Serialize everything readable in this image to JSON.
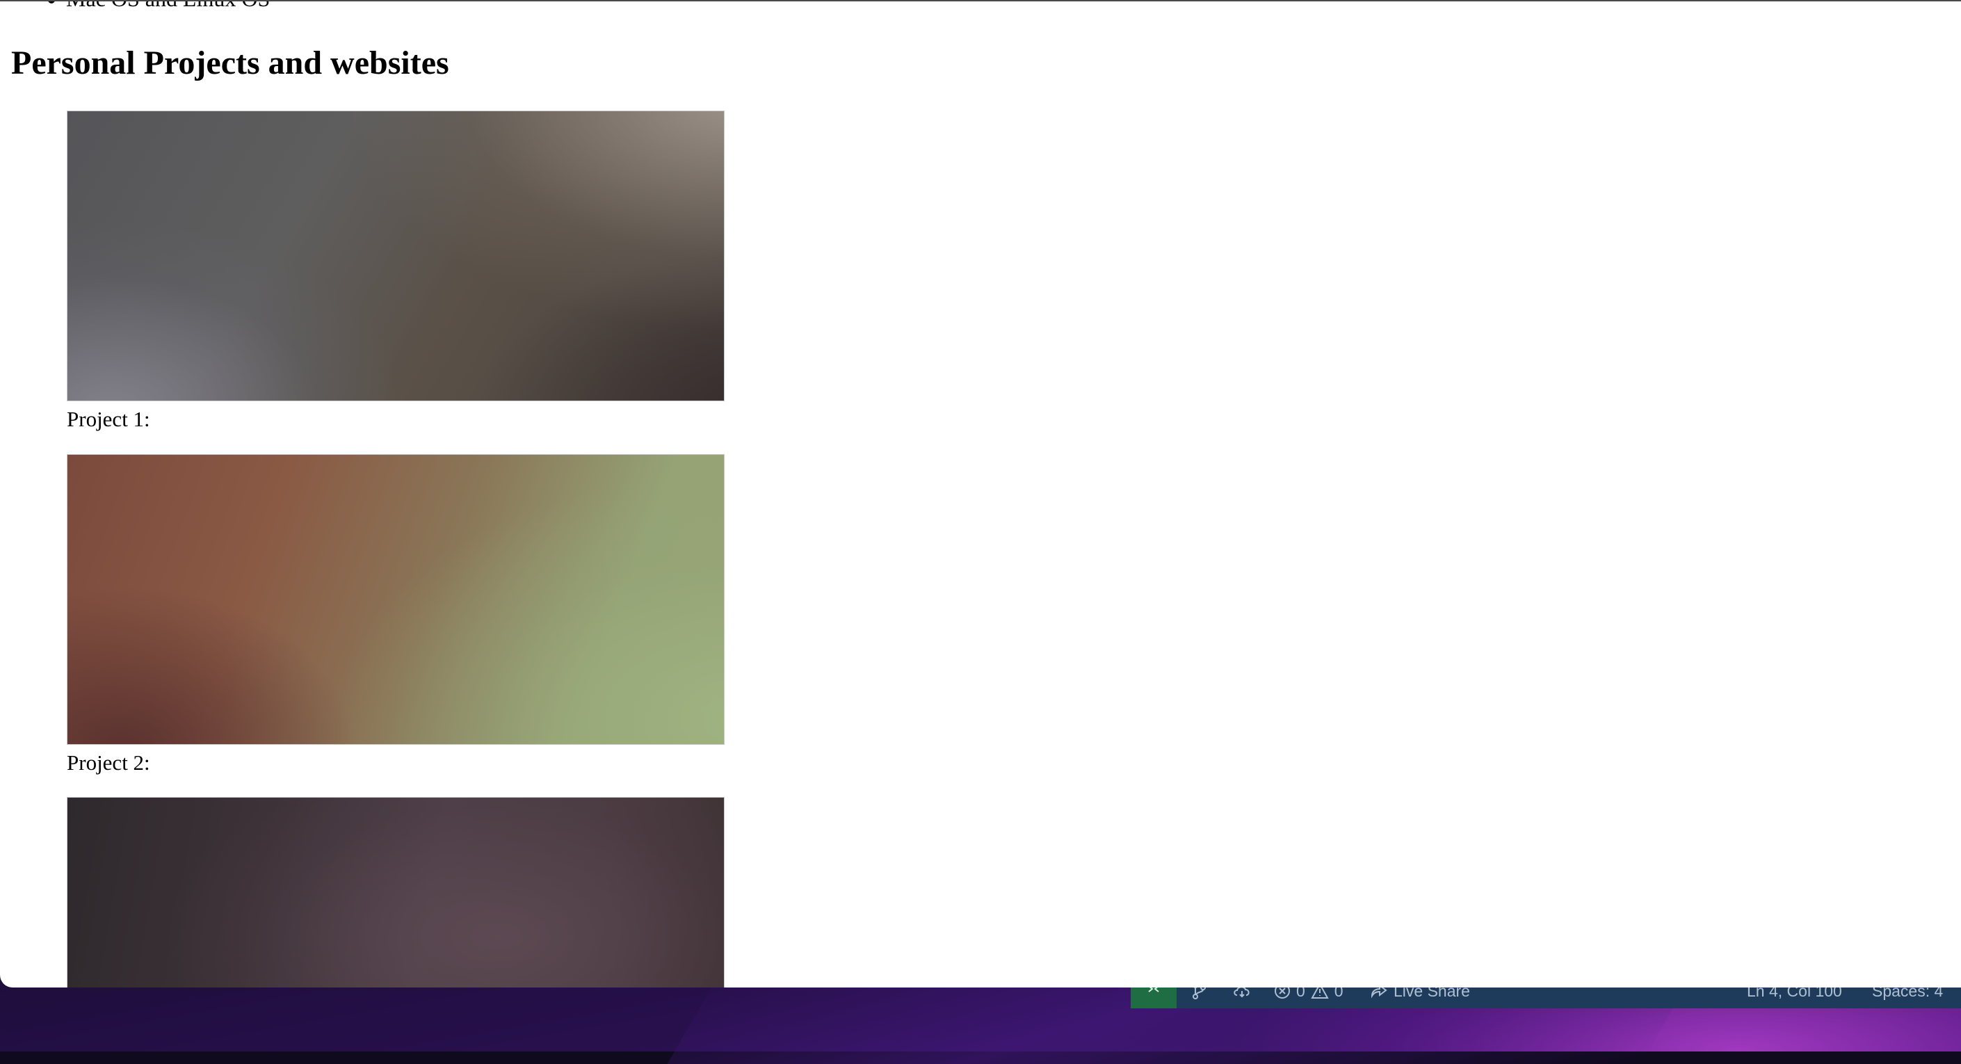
{
  "page": {
    "skills_list_items": [
      "Mac OS and Linux OS"
    ],
    "section_heading": "Personal Projects and websites",
    "projects": [
      {
        "caption": "Project 1:"
      },
      {
        "caption": "Project 2:"
      },
      {
        "caption": ""
      }
    ]
  },
  "statusbar": {
    "remote_icon": "remote-connection-icon",
    "branch_icon": "source-control-icon",
    "sync_icon": "cloud-sync-icon",
    "errors_count": "0",
    "warnings_count": "0",
    "live_share_label": "Live Share",
    "cursor_position": "Ln 4, Col 100",
    "indentation": "Spaces: 4"
  },
  "colors": {
    "statusbar_bg": "#1e3b5c",
    "remote_indicator_bg": "#1f6e43",
    "page_bg": "#ffffff"
  }
}
